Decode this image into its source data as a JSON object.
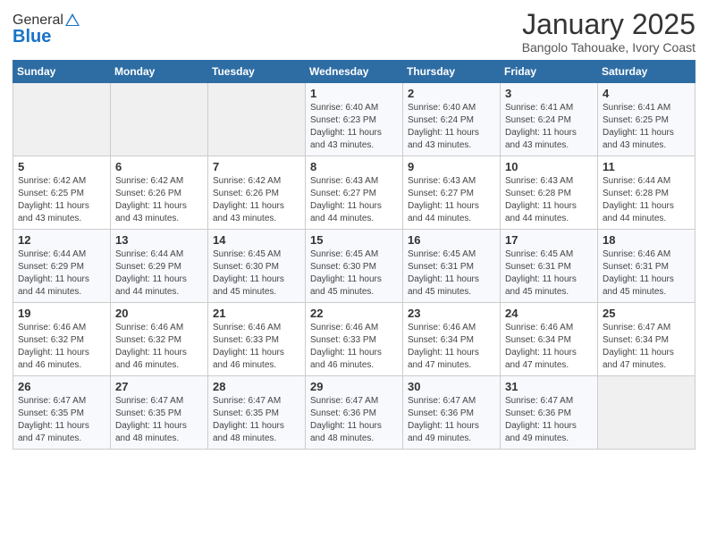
{
  "header": {
    "logo_general": "General",
    "logo_blue": "Blue",
    "month": "January 2025",
    "location": "Bangolo Tahouake, Ivory Coast"
  },
  "weekdays": [
    "Sunday",
    "Monday",
    "Tuesday",
    "Wednesday",
    "Thursday",
    "Friday",
    "Saturday"
  ],
  "weeks": [
    [
      {
        "day": "",
        "info": ""
      },
      {
        "day": "",
        "info": ""
      },
      {
        "day": "",
        "info": ""
      },
      {
        "day": "1",
        "info": "Sunrise: 6:40 AM\nSunset: 6:23 PM\nDaylight: 11 hours\nand 43 minutes."
      },
      {
        "day": "2",
        "info": "Sunrise: 6:40 AM\nSunset: 6:24 PM\nDaylight: 11 hours\nand 43 minutes."
      },
      {
        "day": "3",
        "info": "Sunrise: 6:41 AM\nSunset: 6:24 PM\nDaylight: 11 hours\nand 43 minutes."
      },
      {
        "day": "4",
        "info": "Sunrise: 6:41 AM\nSunset: 6:25 PM\nDaylight: 11 hours\nand 43 minutes."
      }
    ],
    [
      {
        "day": "5",
        "info": "Sunrise: 6:42 AM\nSunset: 6:25 PM\nDaylight: 11 hours\nand 43 minutes."
      },
      {
        "day": "6",
        "info": "Sunrise: 6:42 AM\nSunset: 6:26 PM\nDaylight: 11 hours\nand 43 minutes."
      },
      {
        "day": "7",
        "info": "Sunrise: 6:42 AM\nSunset: 6:26 PM\nDaylight: 11 hours\nand 43 minutes."
      },
      {
        "day": "8",
        "info": "Sunrise: 6:43 AM\nSunset: 6:27 PM\nDaylight: 11 hours\nand 44 minutes."
      },
      {
        "day": "9",
        "info": "Sunrise: 6:43 AM\nSunset: 6:27 PM\nDaylight: 11 hours\nand 44 minutes."
      },
      {
        "day": "10",
        "info": "Sunrise: 6:43 AM\nSunset: 6:28 PM\nDaylight: 11 hours\nand 44 minutes."
      },
      {
        "day": "11",
        "info": "Sunrise: 6:44 AM\nSunset: 6:28 PM\nDaylight: 11 hours\nand 44 minutes."
      }
    ],
    [
      {
        "day": "12",
        "info": "Sunrise: 6:44 AM\nSunset: 6:29 PM\nDaylight: 11 hours\nand 44 minutes."
      },
      {
        "day": "13",
        "info": "Sunrise: 6:44 AM\nSunset: 6:29 PM\nDaylight: 11 hours\nand 44 minutes."
      },
      {
        "day": "14",
        "info": "Sunrise: 6:45 AM\nSunset: 6:30 PM\nDaylight: 11 hours\nand 45 minutes."
      },
      {
        "day": "15",
        "info": "Sunrise: 6:45 AM\nSunset: 6:30 PM\nDaylight: 11 hours\nand 45 minutes."
      },
      {
        "day": "16",
        "info": "Sunrise: 6:45 AM\nSunset: 6:31 PM\nDaylight: 11 hours\nand 45 minutes."
      },
      {
        "day": "17",
        "info": "Sunrise: 6:45 AM\nSunset: 6:31 PM\nDaylight: 11 hours\nand 45 minutes."
      },
      {
        "day": "18",
        "info": "Sunrise: 6:46 AM\nSunset: 6:31 PM\nDaylight: 11 hours\nand 45 minutes."
      }
    ],
    [
      {
        "day": "19",
        "info": "Sunrise: 6:46 AM\nSunset: 6:32 PM\nDaylight: 11 hours\nand 46 minutes."
      },
      {
        "day": "20",
        "info": "Sunrise: 6:46 AM\nSunset: 6:32 PM\nDaylight: 11 hours\nand 46 minutes."
      },
      {
        "day": "21",
        "info": "Sunrise: 6:46 AM\nSunset: 6:33 PM\nDaylight: 11 hours\nand 46 minutes."
      },
      {
        "day": "22",
        "info": "Sunrise: 6:46 AM\nSunset: 6:33 PM\nDaylight: 11 hours\nand 46 minutes."
      },
      {
        "day": "23",
        "info": "Sunrise: 6:46 AM\nSunset: 6:34 PM\nDaylight: 11 hours\nand 47 minutes."
      },
      {
        "day": "24",
        "info": "Sunrise: 6:46 AM\nSunset: 6:34 PM\nDaylight: 11 hours\nand 47 minutes."
      },
      {
        "day": "25",
        "info": "Sunrise: 6:47 AM\nSunset: 6:34 PM\nDaylight: 11 hours\nand 47 minutes."
      }
    ],
    [
      {
        "day": "26",
        "info": "Sunrise: 6:47 AM\nSunset: 6:35 PM\nDaylight: 11 hours\nand 47 minutes."
      },
      {
        "day": "27",
        "info": "Sunrise: 6:47 AM\nSunset: 6:35 PM\nDaylight: 11 hours\nand 48 minutes."
      },
      {
        "day": "28",
        "info": "Sunrise: 6:47 AM\nSunset: 6:35 PM\nDaylight: 11 hours\nand 48 minutes."
      },
      {
        "day": "29",
        "info": "Sunrise: 6:47 AM\nSunset: 6:36 PM\nDaylight: 11 hours\nand 48 minutes."
      },
      {
        "day": "30",
        "info": "Sunrise: 6:47 AM\nSunset: 6:36 PM\nDaylight: 11 hours\nand 49 minutes."
      },
      {
        "day": "31",
        "info": "Sunrise: 6:47 AM\nSunset: 6:36 PM\nDaylight: 11 hours\nand 49 minutes."
      },
      {
        "day": "",
        "info": ""
      }
    ]
  ]
}
